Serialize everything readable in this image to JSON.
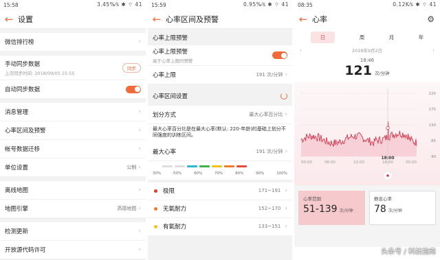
{
  "panel1": {
    "status": {
      "time": "15:58",
      "right": "3.45%⁄s ✱ ⌔ 41"
    },
    "title": "设置",
    "items": [
      {
        "label": "微信排行榜"
      },
      {
        "label": "手动同步数据",
        "sub": "上次同步时间: 2018/09/05 15:55",
        "button": "同步"
      },
      {
        "label": "自动同步数据"
      },
      {
        "label": "消息管理"
      },
      {
        "label": "心率区间及预警"
      },
      {
        "label": "帐号数据迁移"
      },
      {
        "label": "单位设置",
        "value": "公制"
      },
      {
        "label": "离线地图"
      },
      {
        "label": "地图引擎",
        "value": "高德地图"
      },
      {
        "label": "检测更新"
      },
      {
        "label": "开放源代码许可"
      }
    ]
  },
  "panel2": {
    "status": {
      "time": "15:59",
      "right": "0.95%⁄s ✱ ⌔ 41"
    },
    "title": "心率区间及预警",
    "sec1": "心率上限预警",
    "warn_title": "心率上限预警",
    "warn_sub": "高于心率上限时预警",
    "limit_label": "心率上限",
    "limit_value": "191 次/分钟",
    "sec2": "心率区间设置",
    "method_label": "划分方式",
    "method_value": "最大心率百分比",
    "desc": "最大心率百分比是在最大心率(默认: 220-年龄)的基础上划分不同强度的训练区间。",
    "max_label": "最大心率",
    "max_value": "191 次/分钟",
    "pcts": [
      "30%",
      "50%",
      "60%",
      "70%",
      "80%",
      "90%",
      "100%"
    ],
    "bar_colors": [
      "#dddddd",
      "#dddddd",
      "#2db7d2",
      "#3bb54a",
      "#f2c21b",
      "#f07b2b",
      "#e84a3b"
    ],
    "zones": [
      {
        "name": "极限",
        "range": "171~191",
        "color": "#e23b2e"
      },
      {
        "name": "无氧耐力",
        "range": "152~170",
        "color": "#f07b2b"
      },
      {
        "name": "有氧耐力",
        "range": "133~151",
        "color": "#f2c21b"
      }
    ]
  },
  "panel3": {
    "status": {
      "time": "08:35",
      "right": "0.12K⁄s ✱ ⌔ 41"
    },
    "title": "心率",
    "tabs": [
      "日",
      "周",
      "月",
      "年"
    ],
    "date": "2018年9月2日",
    "time": "18:46",
    "bpm": "121",
    "unit": "次/分钟",
    "y_ticks": [
      "220",
      "175",
      "130",
      "85",
      "40"
    ],
    "x_ticks": [
      "00:00",
      "06:00",
      "12:00",
      "18:00",
      "00:00"
    ],
    "marker_time": "18:00",
    "card1": {
      "title": "心率范围",
      "value": "51-139",
      "unit": "次/分钟"
    },
    "card2": {
      "title": "静息心率",
      "value": "78",
      "unit": "次/分钟"
    },
    "watermark": "头条号 / 科技指南"
  }
}
